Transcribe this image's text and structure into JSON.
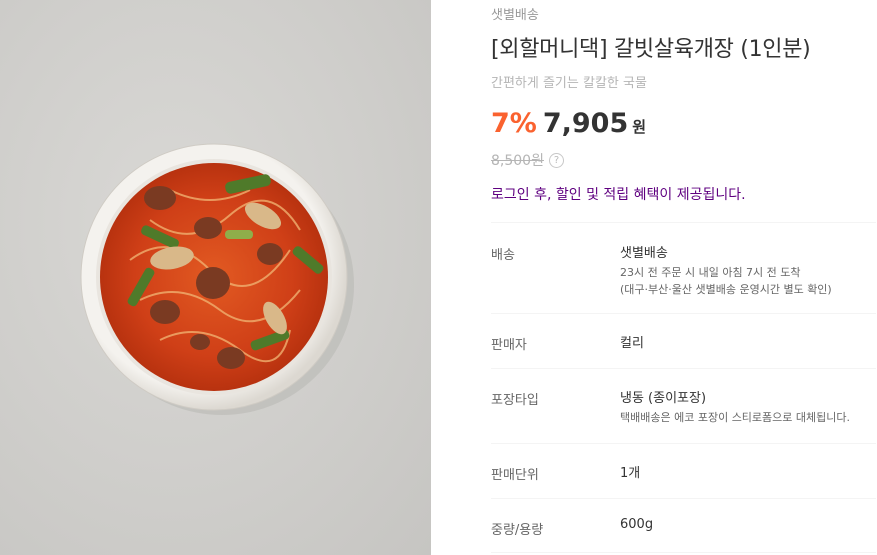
{
  "product": {
    "delivery_tag": "샛별배송",
    "title": "[외할머니댁] 갈빗살육개장 (1인분)",
    "subtitle": "간편하게 즐기는 칼칼한 국물",
    "discount": "7%",
    "price": "7,905",
    "price_unit": "원",
    "original_price": "8,500원",
    "login_notice": "로그인 후, 할인 및 적립 혜택이 제공됩니다."
  },
  "image": {
    "alt_icon": "yukgaejang-soup-bowl-photo"
  },
  "info_rows": [
    {
      "label": "배송",
      "value": "샛별배송",
      "sub1": "23시 전 주문 시 내일 아침 7시 전 도착",
      "sub2": "(대구·부산·울산 샛별배송 운영시간 별도 확인)"
    },
    {
      "label": "판매자",
      "value": "컬리"
    },
    {
      "label": "포장타입",
      "value": "냉동 (종이포장)",
      "sub1": "택배배송은 에코 포장이 스티로폼으로 대체됩니다."
    },
    {
      "label": "판매단위",
      "value": "1개"
    },
    {
      "label": "중량/용량",
      "value": "600g"
    }
  ],
  "colors": {
    "discount": "#fa622f",
    "login_notice": "#5f0080",
    "soup": "#d6461c"
  }
}
